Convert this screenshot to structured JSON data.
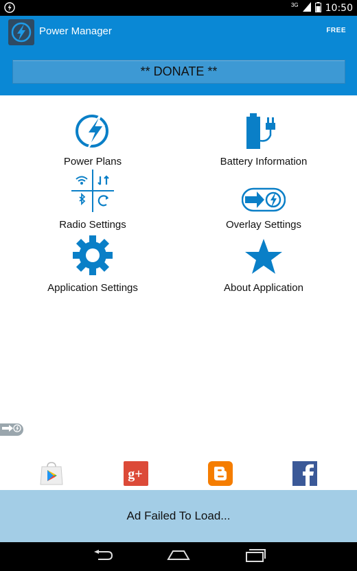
{
  "status_bar": {
    "network": "3G",
    "time": "10:50"
  },
  "app_bar": {
    "title": "Power Manager",
    "badge": "FREE",
    "donate_label": "** DONATE **"
  },
  "menu": [
    {
      "label": "Power Plans",
      "icon": "lightning-bolt-icon"
    },
    {
      "label": "Battery Information",
      "icon": "battery-plug-icon"
    },
    {
      "label": "Radio Settings",
      "icon": "radio-toggles-icon"
    },
    {
      "label": "Overlay Settings",
      "icon": "overlay-arrow-icon"
    },
    {
      "label": "Application Settings",
      "icon": "gear-icon"
    },
    {
      "label": "About Application",
      "icon": "star-icon"
    }
  ],
  "social_links": [
    "play-store-icon",
    "google-plus-icon",
    "blogger-icon",
    "facebook-icon"
  ],
  "ad": {
    "text": "Ad Failed To Load..."
  },
  "colors": {
    "brand_blue": "#0a88d5",
    "icon_blue": "#0a7fc7",
    "ad_bg": "#a3cde6"
  }
}
